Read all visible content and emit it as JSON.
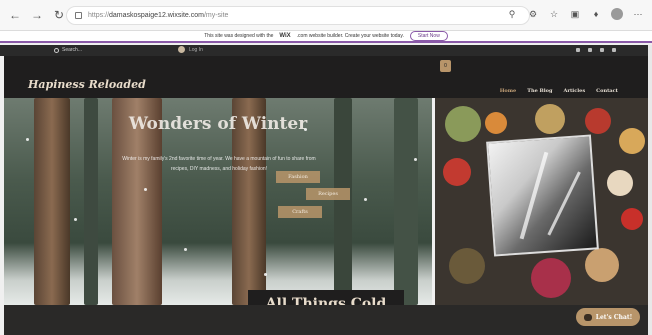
{
  "browser": {
    "url_prefix": "https://",
    "url_host": "damaskospaige12.wixsite.com",
    "url_path": "/my-site",
    "back_icon": "arrow-left-icon",
    "forward_icon": "arrow-right-icon",
    "reload_icon": "reload-icon"
  },
  "wix_banner": {
    "text_before": "This site was designed with the",
    "brand": "WiX",
    "text_after": ".com website builder. Create your website today.",
    "start_label": "Start Now"
  },
  "site_top": {
    "search_placeholder": "Search...",
    "login_label": "Log In"
  },
  "header": {
    "logo": "Hapiness Reloaded",
    "menu": [
      "Home",
      "The Blog",
      "Articles",
      "Contact"
    ],
    "active_menu": "Home",
    "cart_count": "0"
  },
  "hero": {
    "title": "Wonders of Winter",
    "text": "Winter is my family's 2nd favorite time of year. We have a mountain of fun to share from recipes, DIY madness, and holiday fashion!",
    "buttons": [
      "Fashion",
      "Recipes",
      "Crafts"
    ]
  },
  "caption": "All Things Cold",
  "chat": {
    "label": "Let's Chat!"
  },
  "colors": {
    "accent": "#b8956a",
    "dark": "#1f1e1e",
    "wix_purple": "#8a5aa8"
  }
}
